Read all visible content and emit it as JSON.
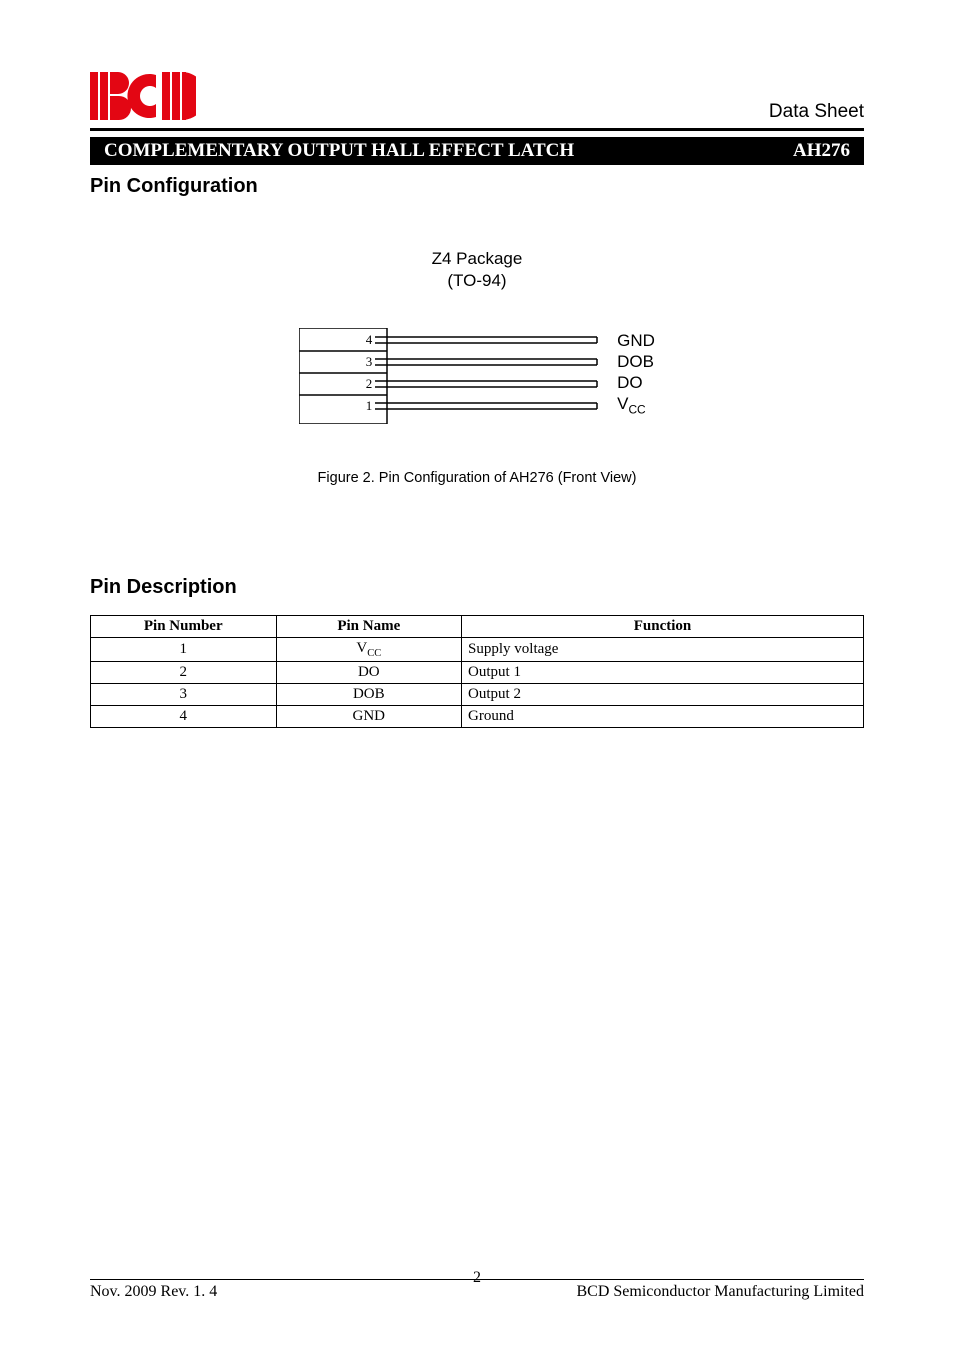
{
  "header": {
    "datasheet_label": "Data Sheet"
  },
  "title_bar": {
    "title": "COMPLEMENTARY OUTPUT HALL EFFECT LATCH",
    "part_number": "AH276"
  },
  "sections": {
    "pin_configuration": "Pin Configuration",
    "pin_description": "Pin Description"
  },
  "package": {
    "name": "Z4 Package",
    "subname": "(TO-94)",
    "pins_internal": [
      "4",
      "3",
      "2",
      "1"
    ],
    "pins_external": [
      "GND",
      "DOB",
      "DO"
    ],
    "vcc_base": "V",
    "vcc_sub": "CC"
  },
  "figure_caption": "Figure 2. Pin Configuration of AH276 (Front View)",
  "pin_table": {
    "headers": [
      "Pin Number",
      "Pin Name",
      "Function"
    ],
    "rows": [
      {
        "num": "1",
        "name_base": "V",
        "name_sub": "CC",
        "func": "Supply voltage"
      },
      {
        "num": "2",
        "name": "DO",
        "func": "Output 1"
      },
      {
        "num": "3",
        "name": "DOB",
        "func": "Output 2"
      },
      {
        "num": "4",
        "name": "GND",
        "func": "Ground"
      }
    ]
  },
  "footer": {
    "left": "Nov. 2009  Rev. 1. 4",
    "right": "BCD Semiconductor Manufacturing Limited",
    "page": "2"
  }
}
